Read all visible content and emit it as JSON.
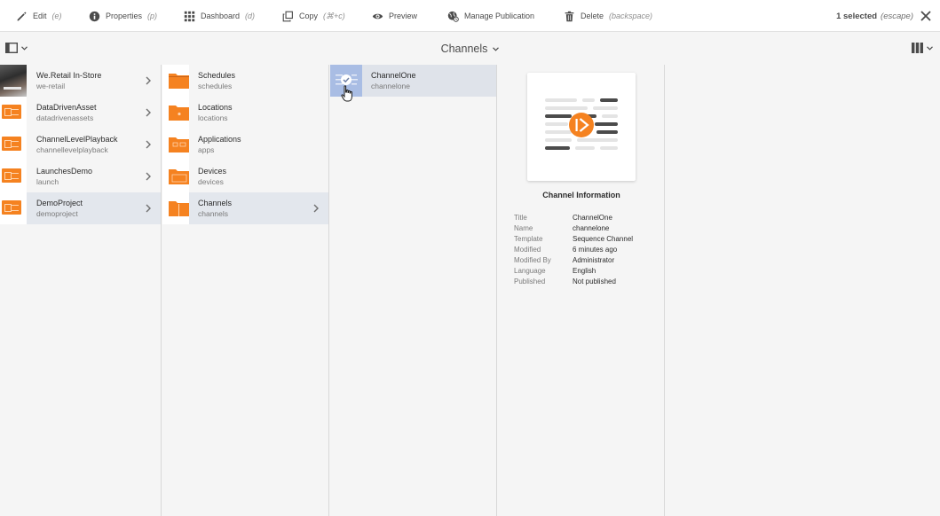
{
  "actionbar": {
    "actions": [
      {
        "label": "Edit",
        "hint": "(e)"
      },
      {
        "label": "Properties",
        "hint": "(p)"
      },
      {
        "label": "Dashboard",
        "hint": "(d)"
      },
      {
        "label": "Copy",
        "hint": "(⌘+c)"
      },
      {
        "label": "Preview",
        "hint": ""
      },
      {
        "label": "Manage Publication",
        "hint": ""
      },
      {
        "label": "Delete",
        "hint": "(backspace)"
      }
    ],
    "selection": {
      "count_label": "1 selected",
      "hint": "(escape)"
    }
  },
  "titlebar": {
    "title": "Channels"
  },
  "columns": {
    "projects": [
      {
        "name": "We.Retail In-Store",
        "sub": "we-retail"
      },
      {
        "name": "DataDrivenAsset",
        "sub": "datadrivenassets"
      },
      {
        "name": "ChannelLevelPlayback",
        "sub": "channellevelplayback"
      },
      {
        "name": "LaunchesDemo",
        "sub": "launch"
      },
      {
        "name": "DemoProject",
        "sub": "demoproject"
      }
    ],
    "folders": [
      {
        "name": "Schedules",
        "sub": "schedules"
      },
      {
        "name": "Locations",
        "sub": "locations"
      },
      {
        "name": "Applications",
        "sub": "apps"
      },
      {
        "name": "Devices",
        "sub": "devices"
      },
      {
        "name": "Channels",
        "sub": "channels"
      }
    ],
    "channels": [
      {
        "name": "ChannelOne",
        "sub": "channelone"
      }
    ]
  },
  "info": {
    "heading": "Channel Information",
    "rows": [
      {
        "key": "Title",
        "value": "ChannelOne"
      },
      {
        "key": "Name",
        "value": "channelone"
      },
      {
        "key": "Template",
        "value": "Sequence Channel"
      },
      {
        "key": "Modified",
        "value": "6 minutes ago"
      },
      {
        "key": "Modified By",
        "value": "Administrator"
      },
      {
        "key": "Language",
        "value": "English"
      },
      {
        "key": "Published",
        "value": "Not published"
      }
    ]
  },
  "colors": {
    "accent": "#f58220",
    "selected_row": "#dfe3ea",
    "selected_thumb": "#a9bde4"
  },
  "icons": [
    "pencil-icon",
    "info-icon",
    "grid-icon",
    "copy-icon",
    "eye-icon",
    "globe-icon",
    "trash-icon",
    "close-icon",
    "sidebar-toggle-icon",
    "chevron-down-icon",
    "columns-icon",
    "folder-icon",
    "chevron-right-icon",
    "check-icon",
    "play-icon",
    "hand-cursor-icon"
  ]
}
